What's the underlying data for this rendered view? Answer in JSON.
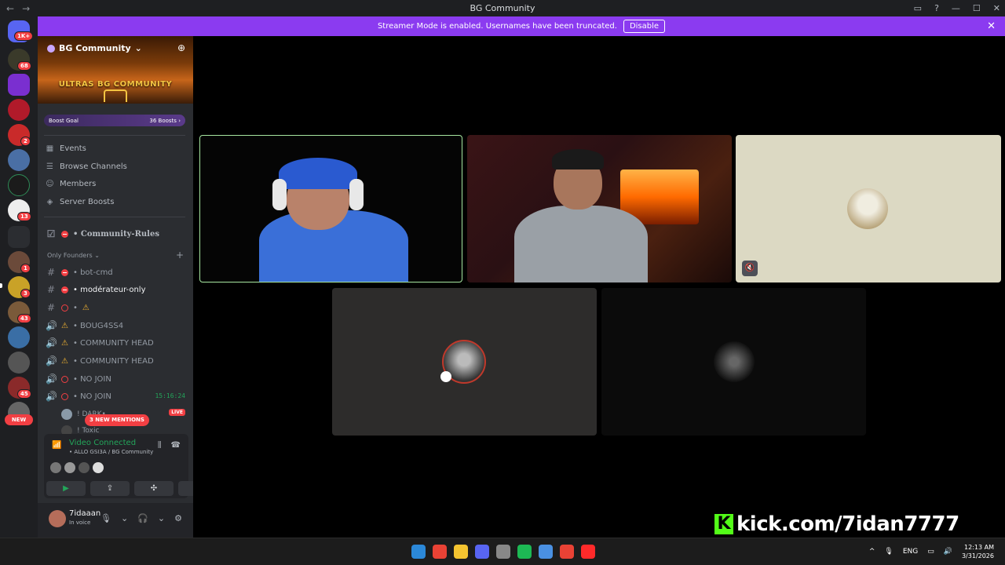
{
  "window": {
    "title": "BG Community",
    "back": "←",
    "forward": "→",
    "controls": [
      "▭",
      "?",
      "—",
      "☐",
      "✕"
    ]
  },
  "banner": {
    "message": "Streamer Mode is enabled. Usernames have been truncated.",
    "disable_label": "Disable",
    "close": "✕"
  },
  "rail": {
    "badges": [
      "1K+",
      "68",
      "2",
      "13",
      "1",
      "3",
      "43",
      "45"
    ],
    "new_label": "NEW"
  },
  "server": {
    "name": "BG Community",
    "chevron": "⌄",
    "banner_text": "ULTRAS BG COMMUNITY",
    "boost_goal": "Boost Goal",
    "boost_count": "36 Boosts",
    "boost_arrow": "›"
  },
  "nav": [
    {
      "label": "Events",
      "icon": "calendar-icon",
      "glyph": "▦"
    },
    {
      "label": "Browse Channels",
      "icon": "browse-icon",
      "glyph": "☰"
    },
    {
      "label": "Members",
      "icon": "members-icon",
      "glyph": "☺"
    },
    {
      "label": "Server Boosts",
      "icon": "boost-icon",
      "glyph": "◈"
    }
  ],
  "rules_channel": "• Community-Rules",
  "category": {
    "label": "Only Founders",
    "chevron": "⌄",
    "add": "+"
  },
  "channels": [
    {
      "prefix": "#",
      "name": "• bot-cmd"
    },
    {
      "prefix": "#",
      "name": "• modérateur-only"
    },
    {
      "prefix": "#",
      "name": "• "
    },
    {
      "prefix": "🔊",
      "name": "• BOUG4SS4"
    },
    {
      "prefix": "🔊",
      "name": "• COMMUNITY HEAD"
    },
    {
      "prefix": "🔊",
      "name": "• COMMUNITY HEAD"
    },
    {
      "prefix": "🔊",
      "name": "• NO JOIN"
    },
    {
      "prefix": "🔊",
      "name": "• NO JOIN"
    }
  ],
  "voice_timer": "15:16:24",
  "voice_members": [
    "! DARK•",
    "! Toxic"
  ],
  "live_label": "LIVE",
  "mentions_label": "3 NEW MENTIONS",
  "voice_panel": {
    "status": "Video Connected",
    "location": "• ALLO GSI3A / BG Community",
    "buttons": [
      "▶",
      "⇪",
      "✣",
      "✧"
    ]
  },
  "user": {
    "name": "7idaaan",
    "status": "In voice",
    "controls": [
      "🎙",
      "⌄",
      "🎧",
      "⌄",
      "⚙"
    ]
  },
  "stream_overlay": {
    "k": "K",
    "text": "kick.com/7idan7777"
  },
  "taskbar": {
    "lang": "ENG",
    "time": "12:13 AM",
    "date": "3/31/2026",
    "tray_icons": [
      "^",
      "🎙"
    ],
    "app_colors": [
      "#2b88d8",
      "#e94235",
      "#f4c430",
      "#5865f2",
      "#888888",
      "#1db954",
      "#4a90e2",
      "#e94235",
      "#ff2a2a"
    ]
  },
  "colors": {
    "banner": "#8b3bf0",
    "speaking_border": "#a6e6a0",
    "connected_green": "#23a55a",
    "kick_green": "#53fc18",
    "danger_red": "#f23f43"
  }
}
